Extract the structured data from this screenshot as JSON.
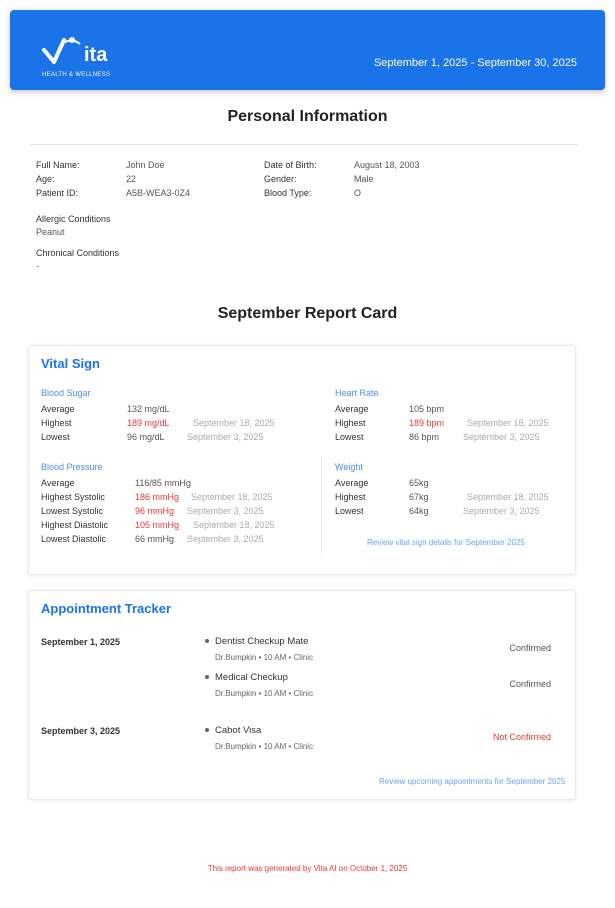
{
  "header": {
    "logo_text": "ita",
    "logo_sub": "HEALTH & WELLNESS",
    "date_range": "September 1, 2025 - September 30, 2025"
  },
  "personal": {
    "title": "Personal Information",
    "left": [
      {
        "label": "Full Name:",
        "value": "John Doe"
      },
      {
        "label": "Age:",
        "value": "22"
      },
      {
        "label": "Patient ID:",
        "value": "A5B-WEA3-0Z4"
      }
    ],
    "right": [
      {
        "label": "Date of Birth:",
        "value": "August 18, 2003"
      },
      {
        "label": "Gender:",
        "value": "Male"
      },
      {
        "label": "Blood Type:",
        "value": "O"
      }
    ],
    "allergy_label": "Allergic Conditions",
    "allergy_value": "Peanut",
    "chronic_label": "Chronical Conditions",
    "chronic_value": "-"
  },
  "report": {
    "title": "September Report Card",
    "vital_title": "Vital Sign",
    "blood_sugar": {
      "title": "Blood Sugar",
      "rows": [
        {
          "label": "Average",
          "value": "132 mg/dL",
          "date": "",
          "high": false
        },
        {
          "label": "Highest",
          "value": "189 mg/dL",
          "date": "September 18, 2025",
          "high": true
        },
        {
          "label": "Lowest",
          "value": "96 mg/dL",
          "date": "September 3, 2025",
          "high": false
        }
      ]
    },
    "heart_rate": {
      "title": "Heart Rate",
      "rows": [
        {
          "label": "Average",
          "value": "105 bpm",
          "date": "",
          "high": false
        },
        {
          "label": "Highest",
          "value": "189 bpm",
          "date": "September 18, 2025",
          "high": true
        },
        {
          "label": "Lowest",
          "value": "86 bpm",
          "date": "September 3, 2025",
          "high": false
        }
      ]
    },
    "blood_pressure": {
      "title": "Blood Pressure",
      "rows": [
        {
          "label": "Average",
          "value": "116/85 mmHg",
          "date": "",
          "high": false
        },
        {
          "label": "Highest Systolic",
          "value": "186 mmHg",
          "date": "September 18, 2025",
          "high": true
        },
        {
          "label": "Lowest Systolic",
          "value": "96 mmHg",
          "date": "September 3, 2025",
          "high": true
        },
        {
          "label": "Highest Diastolic",
          "value": "105 mmHg",
          "date": "September 18, 2025",
          "high": true
        },
        {
          "label": "Lowest Diastolic",
          "value": "66 mmHg",
          "date": "September 3, 2025",
          "high": false
        }
      ]
    },
    "weight": {
      "title": "Weight",
      "rows": [
        {
          "label": "Average",
          "value": "65kg",
          "date": "",
          "high": false
        },
        {
          "label": "Highest",
          "value": "67kg",
          "date": "September 18, 2025",
          "high": false
        },
        {
          "label": "Lowest",
          "value": "64kg",
          "date": "September 3, 2025",
          "high": false
        }
      ]
    },
    "vital_link": "Review vital sign details for September 2025",
    "appt_title": "Appointment Tracker",
    "appointments": [
      {
        "date": "September 1, 2025",
        "name": "Dentist Checkup Mate",
        "detail": "Dr.Bumpkin  •  10 AM  •  Clinic",
        "status": "Confirmed",
        "bad": false
      },
      {
        "date": "",
        "name": "Medical Checkup",
        "detail": "Dr.Bumpkin  •  10 AM  •  Clinic",
        "status": "Confirmed",
        "bad": false
      },
      {
        "date": "September 3, 2025",
        "name": "Cabot Visa",
        "detail": "Dr.Bumpkin  •  10 AM  •  Clinic",
        "status": "Not Confirmed",
        "bad": true
      }
    ],
    "appt_link": "Review upcoming appointments for September 2025"
  },
  "footer": "This report was generated by Vita AI on October 1, 2025",
  "colors": {
    "brand": "#1a73e8",
    "alert": "#e53935"
  }
}
